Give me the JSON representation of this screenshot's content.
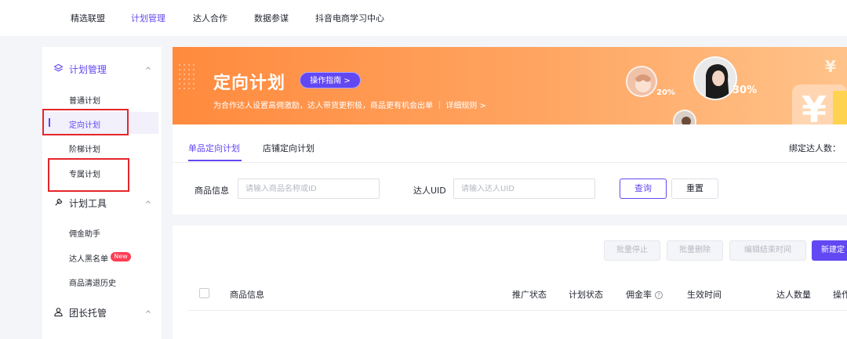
{
  "topnav": {
    "items": [
      {
        "label": "精选联盟",
        "active": false
      },
      {
        "label": "计划管理",
        "active": true
      },
      {
        "label": "达人合作",
        "active": false
      },
      {
        "label": "数据参谋",
        "active": false
      },
      {
        "label": "抖音电商学习中心",
        "active": false
      }
    ]
  },
  "sidebar": {
    "plan_group": {
      "label": "计划管理",
      "icon": "layers-icon",
      "items": [
        {
          "label": "普通计划"
        },
        {
          "label": "定向计划",
          "active": true
        },
        {
          "label": "阶梯计划"
        },
        {
          "label": "专属计划"
        }
      ]
    },
    "tools_group": {
      "label": "计划工具",
      "icon": "tool-icon",
      "items": [
        {
          "label": "佣金助手"
        },
        {
          "label": "达人黑名单",
          "badge": "New"
        },
        {
          "label": "商品清退历史"
        }
      ]
    },
    "leader_group": {
      "label": "团长托管",
      "icon": "leader-icon"
    }
  },
  "banner": {
    "title": "定向计划",
    "guide_button": "操作指南 >",
    "description": "为合作达人设置高佣激励，达人带货更积极，商品更有机会出单 ｜ 详细规则 >",
    "percent_1": "20%",
    "percent_2": "30%"
  },
  "tabs": [
    {
      "label": "单品定向计划",
      "active": true
    },
    {
      "label": "店铺定向计划",
      "active": false
    }
  ],
  "bind_count_label": "绑定达人数：",
  "filters": {
    "product_label": "商品信息",
    "product_placeholder": "请输入商品名称或ID",
    "uid_label": "达人UID",
    "uid_placeholder": "请输入达人UID",
    "query_button": "查询",
    "reset_button": "重置"
  },
  "toolbar": {
    "batch_stop": "批量停止",
    "batch_delete": "批量删除",
    "edit_end_time": "编辑结束时间",
    "new_plan": "新建定"
  },
  "table": {
    "columns": [
      "商品信息",
      "推广状态",
      "计划状态",
      "佣金率",
      "生效时间",
      "达人数量",
      "操作"
    ]
  },
  "colors": {
    "accent": "#6248f2",
    "banner_orange": "#ff8a3d",
    "highlight_red": "#e5262a",
    "badge_red": "#ff3b53"
  }
}
